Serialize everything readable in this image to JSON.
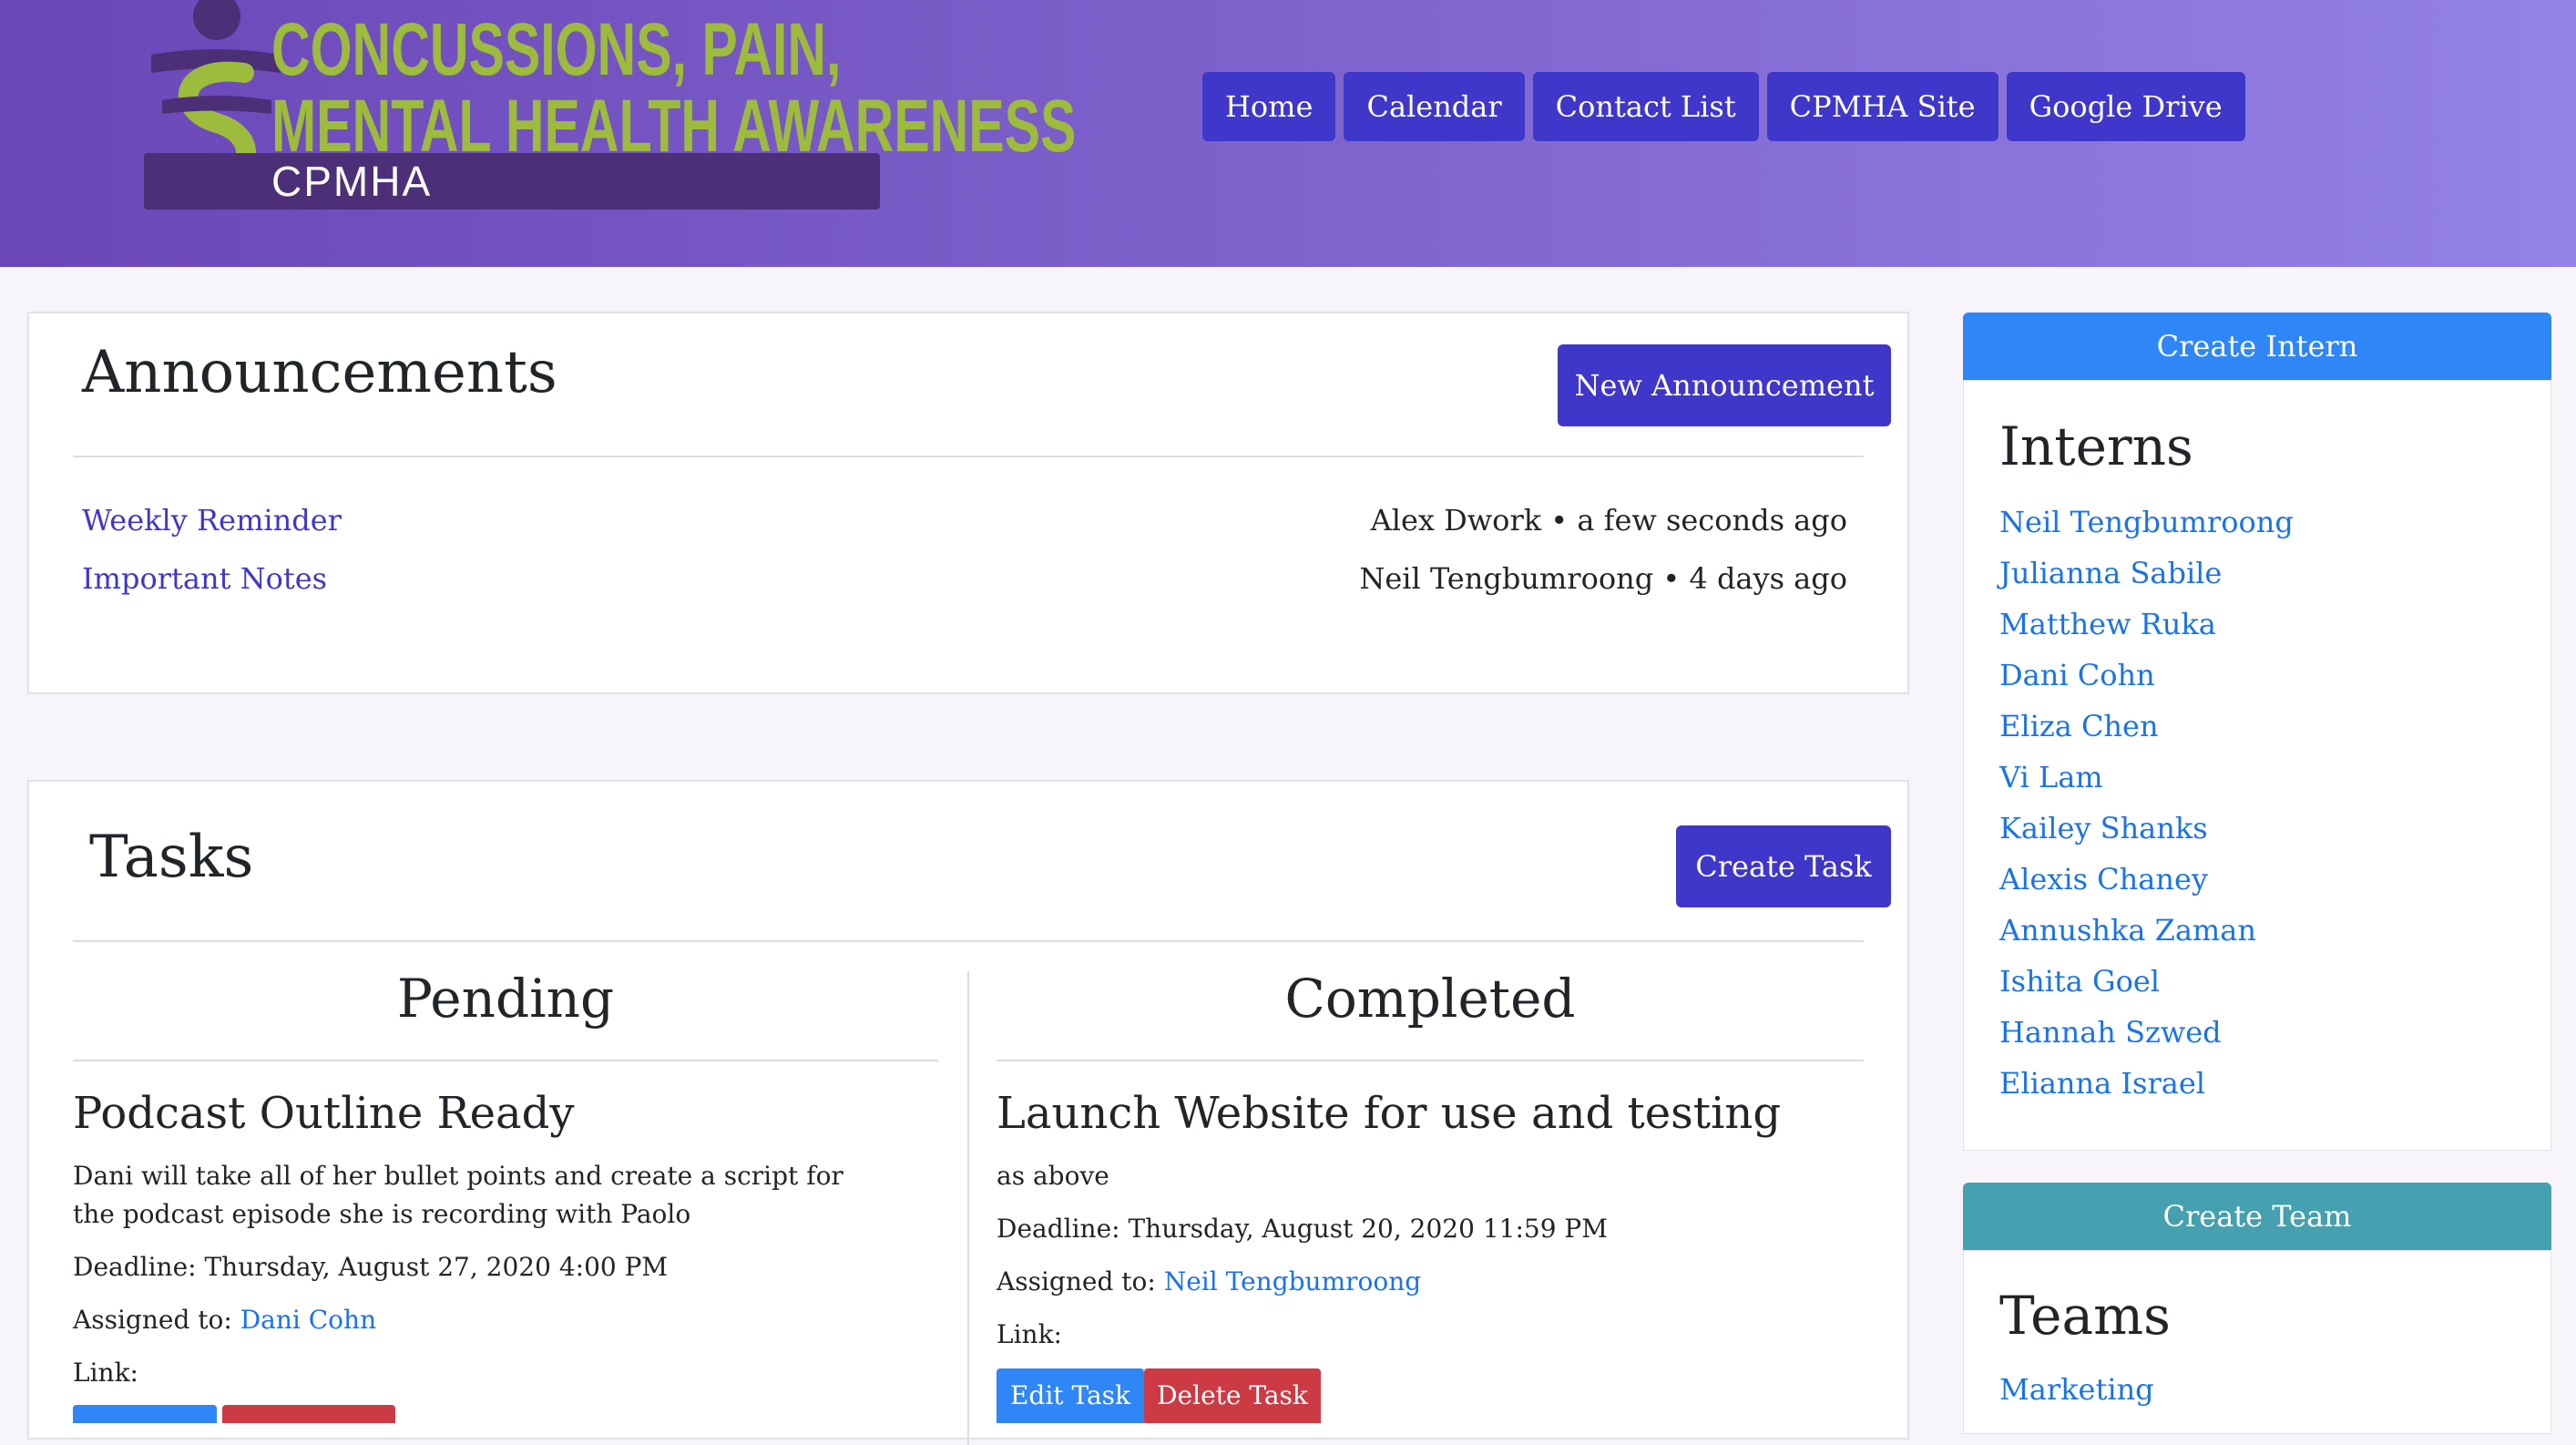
{
  "logo": {
    "line1": "CONCUSSIONS, PAIN,",
    "line2": "MENTAL HEALTH AWARENESS",
    "line3": "CPMHA"
  },
  "nav": [
    "Home",
    "Calendar",
    "Contact List",
    "CPMHA Site",
    "Google Drive"
  ],
  "announcements": {
    "title": "Announcements",
    "new_button": "New Announcement",
    "items": [
      {
        "title": "Weekly Reminder",
        "meta": "Alex Dwork • a few seconds ago"
      },
      {
        "title": "Important Notes",
        "meta": "Neil Tengbumroong • 4 days ago"
      }
    ]
  },
  "tasks": {
    "title": "Tasks",
    "create_button": "Create Task",
    "pending": {
      "heading": "Pending",
      "task": {
        "title": "Podcast Outline Ready",
        "description": "Dani will take all of her bullet points and create a script for the podcast episode she is recording with Paolo",
        "deadline": "Deadline: Thursday, August 27, 2020 4:00 PM",
        "assigned_label": "Assigned to:",
        "assigned_to": "Dani Cohn",
        "link_label": "Link:"
      }
    },
    "completed": {
      "heading": "Completed",
      "task": {
        "title": "Launch Website for use and testing",
        "description": "as above",
        "deadline": "Deadline: Thursday, August 20, 2020 11:59 PM",
        "assigned_label": "Assigned to:",
        "assigned_to": "Neil Tengbumroong",
        "link_label": "Link:",
        "edit_button": "Edit Task",
        "delete_button": "Delete Task"
      }
    }
  },
  "sidebar": {
    "create_intern": "Create Intern",
    "interns_title": "Interns",
    "interns": [
      "Neil Tengbumroong",
      "Julianna Sabile",
      "Matthew Ruka",
      "Dani Cohn",
      "Eliza Chen",
      "Vi Lam",
      "Kailey Shanks",
      "Alexis Chaney",
      "Annushka Zaman",
      "Ishita Goel",
      "Hannah Szwed",
      "Elianna Israel"
    ],
    "create_team": "Create Team",
    "teams_title": "Teams",
    "teams": [
      "Marketing"
    ]
  },
  "colors": {
    "primary": "#3f37c9",
    "create_intern": "#2f86f6",
    "create_team": "#45a0b0",
    "edit": "#2f86f6",
    "delete": "#cc3b44",
    "link": "#1a73e8"
  }
}
